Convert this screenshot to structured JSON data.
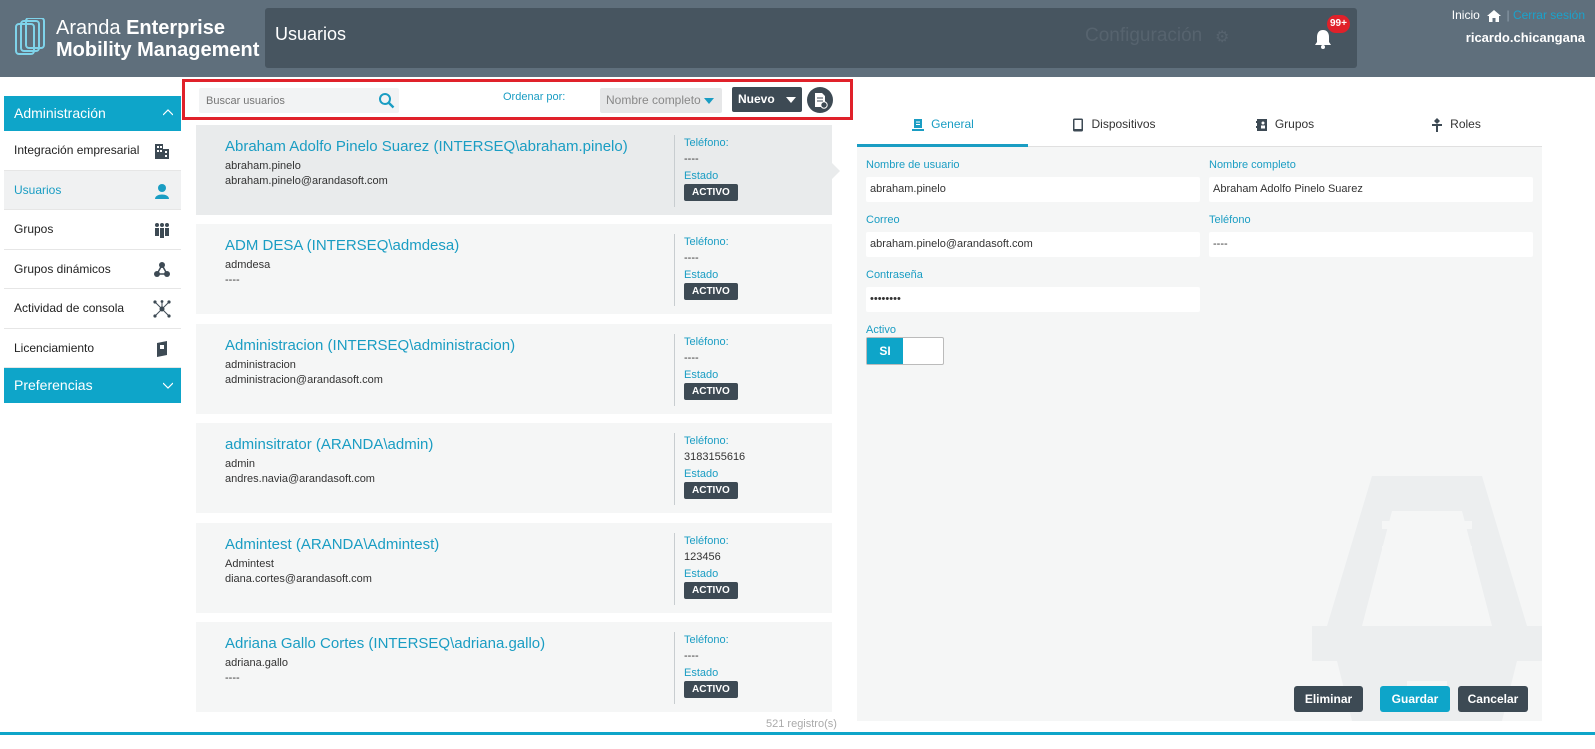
{
  "app": {
    "brand_light": "Aranda",
    "brand_bold1": "Enterprise",
    "brand_bold2": "Mobility Management",
    "page_title": "Usuarios",
    "config_label": "Configuración",
    "notifications_badge": "99+",
    "home_link": "Inicio",
    "separator": "|",
    "logout_link": "Cerrar sesión",
    "username": "ricardo.chicangana"
  },
  "sidebar": {
    "admin_header": "Administración",
    "items": [
      {
        "label": "Integración empresarial",
        "icon": "building-icon"
      },
      {
        "label": "Usuarios",
        "icon": "user-icon"
      },
      {
        "label": "Grupos",
        "icon": "group-icon"
      },
      {
        "label": "Grupos dinámicos",
        "icon": "dynamic-group-icon"
      },
      {
        "label": "Actividad de consola",
        "icon": "network-icon"
      },
      {
        "label": "Licenciamiento",
        "icon": "license-book-icon"
      }
    ],
    "prefs_header": "Preferencias"
  },
  "toolbar": {
    "search_placeholder": "Buscar usuarios",
    "order_label": "Ordenar por:",
    "order_value": "Nombre completo",
    "new_label": "Nuevo"
  },
  "user_list": {
    "phone_label": "Teléfono:",
    "state_label": "Estado",
    "users": [
      {
        "name": "Abraham Adolfo Pinelo Suarez (INTERSEQ\\abraham.pinelo)",
        "login": "abraham.pinelo",
        "email": "abraham.pinelo@arandasoft.com",
        "phone": "----",
        "state": "ACTIVO"
      },
      {
        "name": "ADM DESA (INTERSEQ\\admdesa)",
        "login": "admdesa",
        "email": "----",
        "phone": "----",
        "state": "ACTIVO"
      },
      {
        "name": "Administracion (INTERSEQ\\administracion)",
        "login": "administracion",
        "email": "administracion@arandasoft.com",
        "phone": "----",
        "state": "ACTIVO"
      },
      {
        "name": "adminsitrator (ARANDA\\admin)",
        "login": "admin",
        "email": "andres.navia@arandasoft.com",
        "phone": "3183155616",
        "state": "ACTIVO"
      },
      {
        "name": "Admintest (ARANDA\\Admintest)",
        "login": "Admintest",
        "email": "diana.cortes@arandasoft.com",
        "phone": "123456",
        "state": "ACTIVO"
      },
      {
        "name": "Adriana Gallo Cortes (INTERSEQ\\adriana.gallo)",
        "login": "adriana.gallo",
        "email": "----",
        "phone": "----",
        "state": "ACTIVO"
      }
    ],
    "records": "521 registro(s)"
  },
  "detail": {
    "tabs": [
      "General",
      "Dispositivos",
      "Grupos",
      "Roles"
    ],
    "username_label": "Nombre de usuario",
    "username_value": "abraham.pinelo",
    "fullname_label": "Nombre completo",
    "fullname_value": "Abraham Adolfo Pinelo Suarez",
    "email_label": "Correo",
    "email_value": "abraham.pinelo@arandasoft.com",
    "phone_label": "Teléfono",
    "phone_value": "----",
    "password_label": "Contraseña",
    "password_value": "••••••••",
    "active_label": "Activo",
    "active_value": "SI",
    "delete_btn": "Eliminar",
    "save_btn": "Guardar",
    "cancel_btn": "Cancelar"
  },
  "colors": {
    "accent": "#0ea5c9",
    "header_bg": "#5f6f7c",
    "dark_button": "#3d4a54",
    "highlight_border": "#e0212a"
  }
}
